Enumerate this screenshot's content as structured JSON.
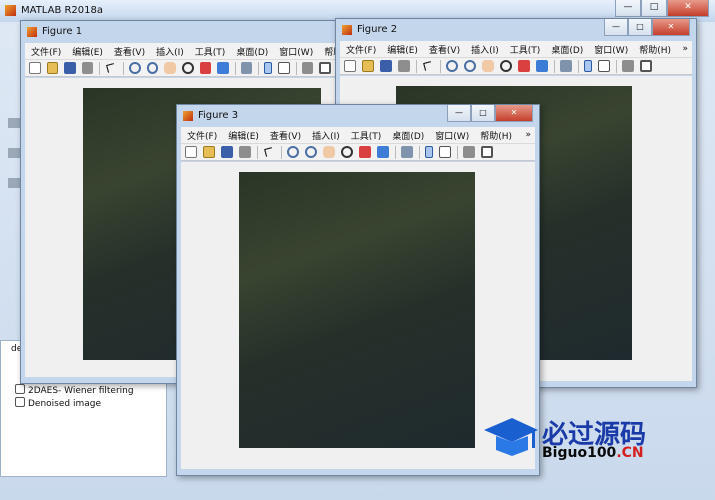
{
  "matlab": {
    "title": "MATLAB R2018a",
    "window_buttons": {
      "minimize": "—",
      "maximize": "□",
      "close": "✕"
    },
    "workspace_items": [
      {
        "label": "2DAES- Wiener filtering"
      },
      {
        "label": "Denoised image"
      }
    ],
    "cut_label": "de"
  },
  "menu_labels": [
    "文件(F)",
    "编辑(E)",
    "查看(V)",
    "插入(I)",
    "工具(T)",
    "桌面(D)",
    "窗口(W)",
    "帮助(H)"
  ],
  "menu_more": "»",
  "toolbar_icons": [
    "new-file-icon",
    "open-folder-icon",
    "save-icon",
    "print-icon",
    "pointer-arrow-icon",
    "zoom-in-icon",
    "zoom-out-icon",
    "pan-hand-icon",
    "rotate-3d-icon",
    "data-cursor-icon",
    "brush-icon",
    "link-plot-icon",
    "colorbar-icon",
    "legend-icon",
    "hide-plot-tools-icon",
    "show-plot-tools-icon"
  ],
  "figures": [
    {
      "title": "Figure 1",
      "menu_more_label": "帮助"
    },
    {
      "title": "Figure 2",
      "menu_more_label": "帮助(H)"
    },
    {
      "title": "Figure 3",
      "menu_more_label": "帮助(H)"
    }
  ],
  "image_caption": "",
  "watermark": {
    "brand": "必过源码",
    "domain_prefix": "Biguo100",
    "domain_suffix": ".CN"
  },
  "colors": {
    "title_bar": "#c4d6ec",
    "close_button": "#c53f2c",
    "brand_blue": "#1a3aa8",
    "brand_red": "#d41f1f"
  }
}
